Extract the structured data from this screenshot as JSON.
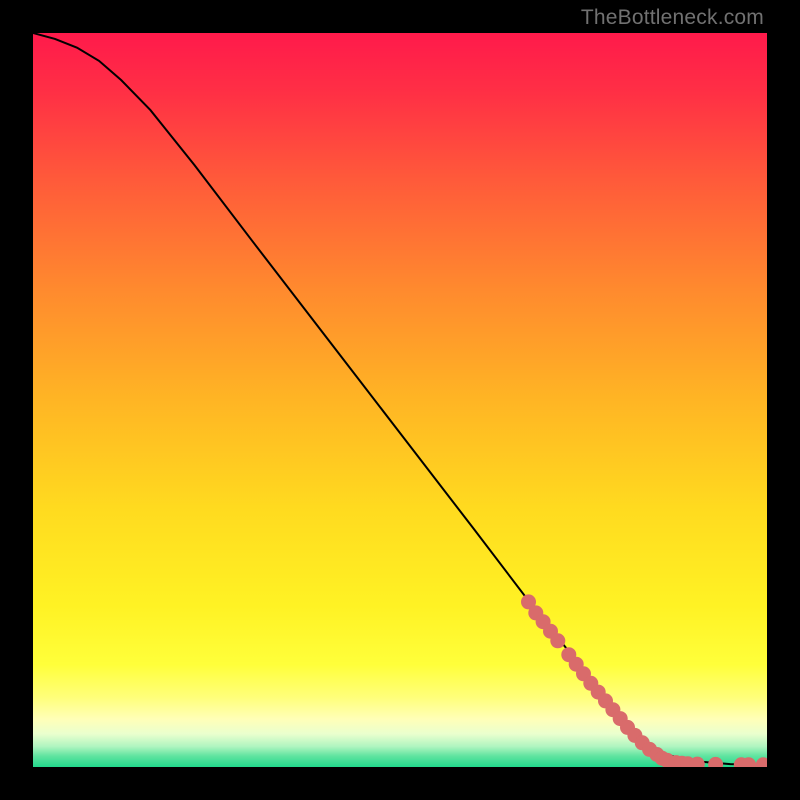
{
  "watermark": "TheBottleneck.com",
  "colors": {
    "point_fill": "#d96b6b",
    "curve_stroke": "#000000",
    "frame_bg": "#000000"
  },
  "chart_data": {
    "type": "line",
    "title": "",
    "xlabel": "",
    "ylabel": "",
    "xlim": [
      0,
      100
    ],
    "ylim": [
      0,
      100
    ],
    "gradient_stops": [
      {
        "offset": 0.0,
        "color": "#ff1a4b"
      },
      {
        "offset": 0.08,
        "color": "#ff2f45"
      },
      {
        "offset": 0.2,
        "color": "#ff5a3a"
      },
      {
        "offset": 0.35,
        "color": "#ff8a2e"
      },
      {
        "offset": 0.5,
        "color": "#ffb524"
      },
      {
        "offset": 0.65,
        "color": "#ffdb1f"
      },
      {
        "offset": 0.78,
        "color": "#fff224"
      },
      {
        "offset": 0.86,
        "color": "#ffff3a"
      },
      {
        "offset": 0.905,
        "color": "#ffff7a"
      },
      {
        "offset": 0.935,
        "color": "#ffffb8"
      },
      {
        "offset": 0.955,
        "color": "#eaffce"
      },
      {
        "offset": 0.972,
        "color": "#b0f5c0"
      },
      {
        "offset": 0.985,
        "color": "#60e4a0"
      },
      {
        "offset": 1.0,
        "color": "#22d98c"
      }
    ],
    "series": [
      {
        "name": "bottleneck-curve",
        "x": [
          0,
          3,
          6,
          9,
          12,
          16,
          22,
          30,
          40,
          50,
          60,
          68,
          72,
          76,
          79,
          82,
          85,
          90,
          95,
          100
        ],
        "y": [
          100,
          99.2,
          98.0,
          96.2,
          93.6,
          89.5,
          82.0,
          71.5,
          58.5,
          45.5,
          32.5,
          22.0,
          17.0,
          12.0,
          8.0,
          4.5,
          2.0,
          0.8,
          0.4,
          0.3
        ]
      }
    ],
    "scatter": {
      "name": "highlighted-segment",
      "points": [
        {
          "x": 67.5,
          "y": 22.5
        },
        {
          "x": 68.5,
          "y": 21.0
        },
        {
          "x": 69.5,
          "y": 19.8
        },
        {
          "x": 70.5,
          "y": 18.5
        },
        {
          "x": 71.5,
          "y": 17.2
        },
        {
          "x": 73.0,
          "y": 15.3
        },
        {
          "x": 74.0,
          "y": 14.0
        },
        {
          "x": 75.0,
          "y": 12.7
        },
        {
          "x": 76.0,
          "y": 11.4
        },
        {
          "x": 77.0,
          "y": 10.2
        },
        {
          "x": 78.0,
          "y": 9.0
        },
        {
          "x": 79.0,
          "y": 7.8
        },
        {
          "x": 80.0,
          "y": 6.6
        },
        {
          "x": 81.0,
          "y": 5.4
        },
        {
          "x": 82.0,
          "y": 4.3
        },
        {
          "x": 83.0,
          "y": 3.3
        },
        {
          "x": 84.0,
          "y": 2.4
        },
        {
          "x": 85.0,
          "y": 1.7
        },
        {
          "x": 85.7,
          "y": 1.2
        },
        {
          "x": 86.4,
          "y": 0.9
        },
        {
          "x": 87.6,
          "y": 0.6
        },
        {
          "x": 88.4,
          "y": 0.5
        },
        {
          "x": 89.2,
          "y": 0.45
        },
        {
          "x": 90.5,
          "y": 0.4
        },
        {
          "x": 93.0,
          "y": 0.35
        },
        {
          "x": 96.5,
          "y": 0.3
        },
        {
          "x": 97.5,
          "y": 0.3
        },
        {
          "x": 99.5,
          "y": 0.3
        }
      ]
    }
  }
}
